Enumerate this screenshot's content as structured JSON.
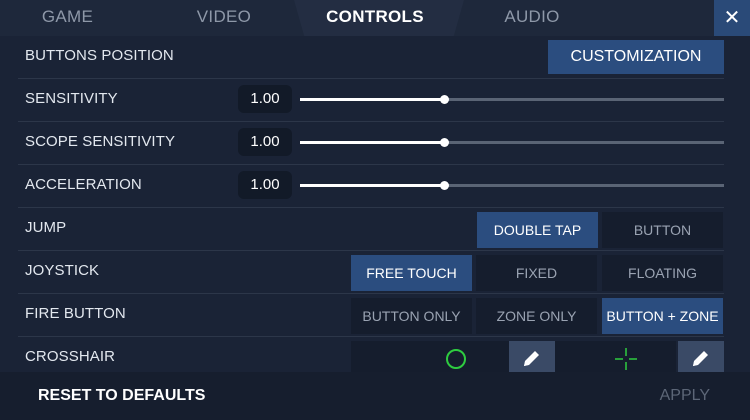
{
  "tabs": [
    {
      "label": "GAME"
    },
    {
      "label": "VIDEO"
    },
    {
      "label": "CONTROLS"
    },
    {
      "label": "AUDIO"
    }
  ],
  "active_tab": "CONTROLS",
  "close_label": "✕",
  "settings": {
    "buttons_position": {
      "label": "BUTTONS POSITION",
      "button": "CUSTOMIZATION"
    },
    "sensitivity": {
      "label": "SENSITIVITY",
      "value": "1.00",
      "fraction": 0.34
    },
    "scope_sensitivity": {
      "label": "SCOPE SENSITIVITY",
      "value": "1.00",
      "fraction": 0.34
    },
    "acceleration": {
      "label": "ACCELERATION",
      "value": "1.00",
      "fraction": 0.34
    },
    "jump": {
      "label": "JUMP",
      "options": [
        "DOUBLE TAP",
        "BUTTON"
      ],
      "selected": "DOUBLE TAP"
    },
    "joystick": {
      "label": "JOYSTICK",
      "options": [
        "FREE TOUCH",
        "FIXED",
        "FLOATING"
      ],
      "selected": "FREE TOUCH"
    },
    "fire_button": {
      "label": "FIRE BUTTON",
      "options": [
        "BUTTON ONLY",
        "ZONE ONLY",
        "BUTTON + ZONE"
      ],
      "selected": "BUTTON + ZONE"
    },
    "crosshair": {
      "label": "CROSSHAIR",
      "icons": [
        "circle-crosshair-icon",
        "plus-crosshair-icon",
        "pencil-icon"
      ],
      "color": "#2ecc40"
    }
  },
  "footer": {
    "reset": "RESET TO DEFAULTS",
    "apply": "APPLY"
  },
  "colors": {
    "accent": "#2b4d7f",
    "background": "#1a2336",
    "crosshair": "#2ecc40"
  }
}
